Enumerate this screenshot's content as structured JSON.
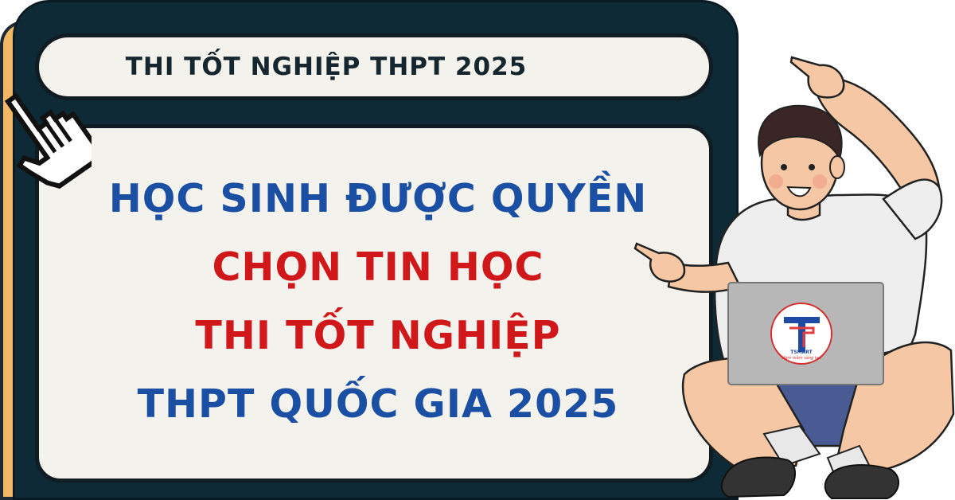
{
  "header": {
    "title": "THI TỐT NGHIỆP THPT 2025"
  },
  "headline": {
    "line1": "HỌC SINH ĐƯỢC QUYỀN",
    "line2": "CHỌN TIN HỌC",
    "line3": "THI TỐT NGHIỆP",
    "line4": "THPT QUỐC GIA 2025"
  },
  "laptop_logo": {
    "brand": "TSMART",
    "tagline": "Ươm mầm sáng tạo"
  },
  "colors": {
    "board": "#0e2a36",
    "panel": "#f4f2ec",
    "blue_text": "#1a4fa3",
    "red_text": "#d0171a",
    "accent": "#f2b866"
  }
}
